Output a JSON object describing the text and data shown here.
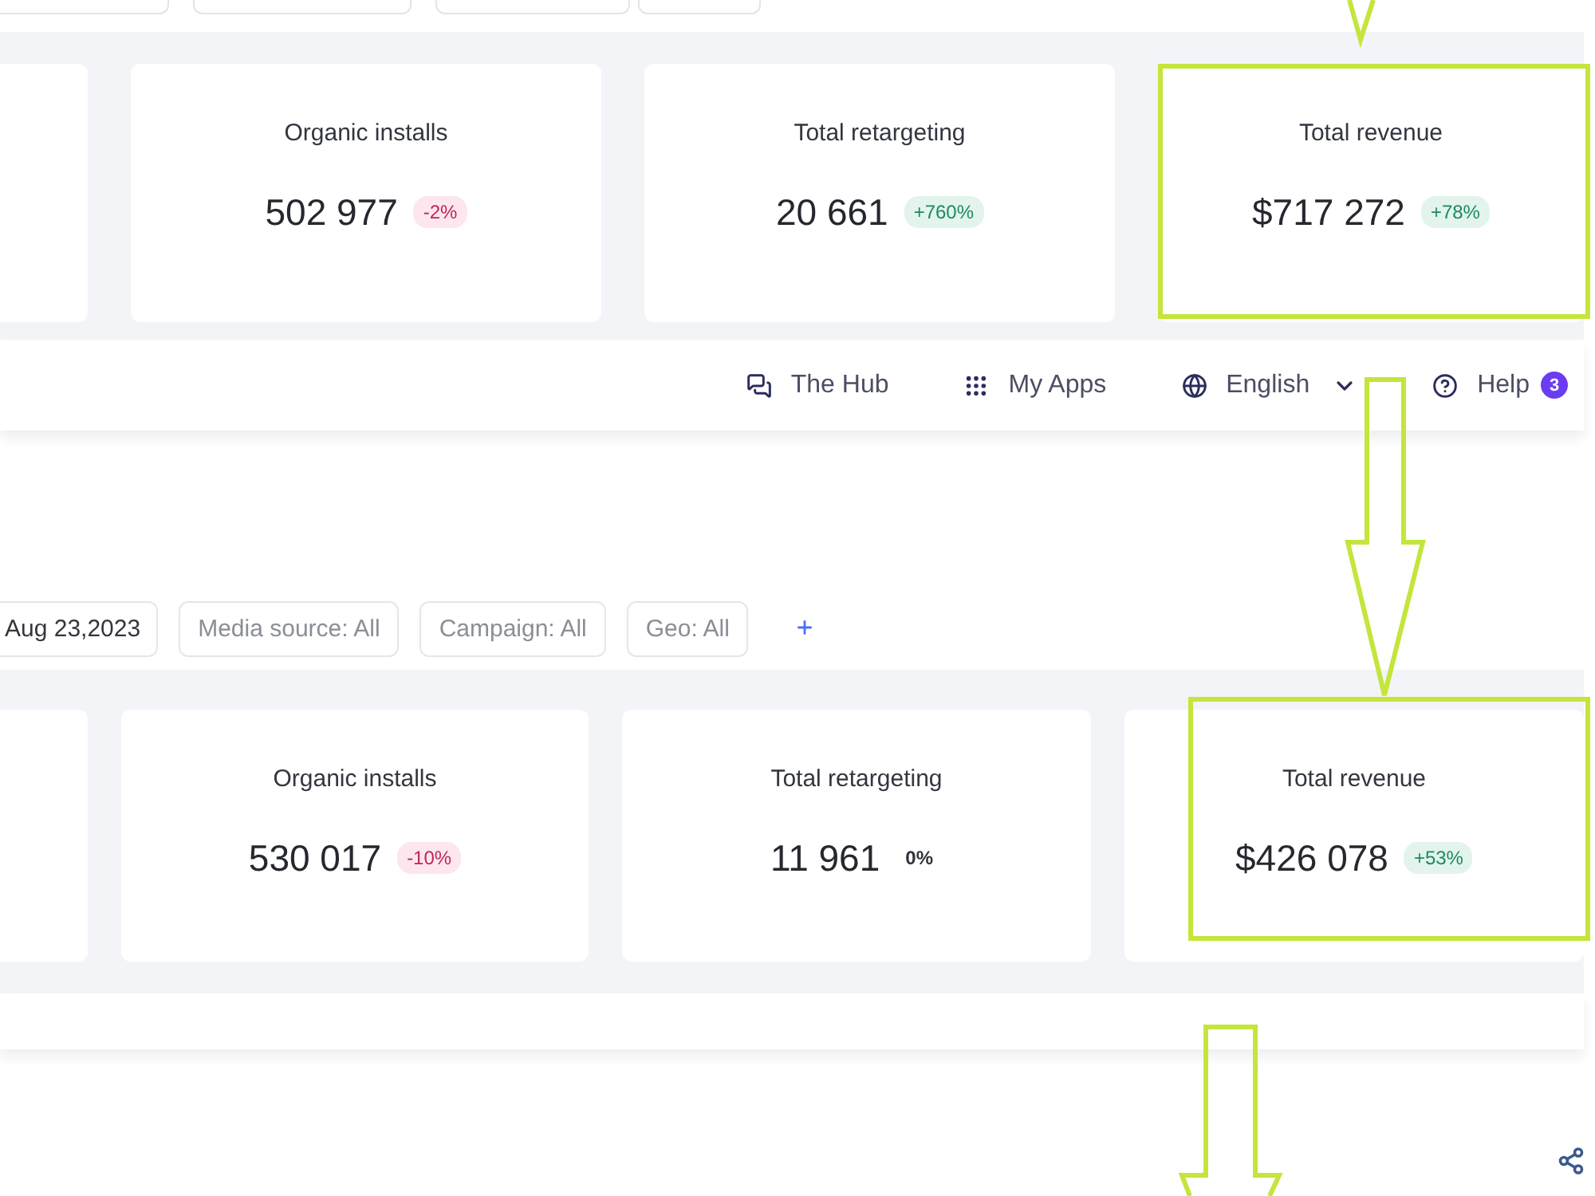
{
  "summary_top": {
    "cards": [
      {
        "label": "Organic installs",
        "value": "502 977",
        "change": "-2%",
        "kind": "down",
        "highlighted": false
      },
      {
        "label": "Total retargeting",
        "value": "20 661",
        "change": "+760%",
        "kind": "up",
        "highlighted": false
      },
      {
        "label": "Total revenue",
        "value": "$717 272",
        "change": "+78%",
        "kind": "up",
        "highlighted": true
      }
    ]
  },
  "nav_bar": {
    "items": [
      {
        "label": "The Hub",
        "kind": "chat",
        "dropdown": false
      },
      {
        "label": "My Apps",
        "kind": "grid",
        "dropdown": false
      },
      {
        "label": "English",
        "kind": "globe",
        "dropdown": true
      },
      {
        "label": "Help",
        "kind": "help",
        "dropdown": false,
        "badge": "3"
      }
    ]
  },
  "filters": [
    {
      "label": "Aug 23,2023",
      "kind": "date"
    },
    {
      "label": "Media source: All",
      "kind": "select"
    },
    {
      "label": "Campaign: All",
      "kind": "select"
    },
    {
      "label": "Geo: All",
      "kind": "select"
    }
  ],
  "summary_bottom": {
    "cards": [
      {
        "label": "Organic installs",
        "value": "530 017",
        "change": "-10%",
        "kind": "down",
        "highlighted": false
      },
      {
        "label": "Total retargeting",
        "value": "11 961",
        "change": "0%",
        "kind": "flat",
        "highlighted": false
      },
      {
        "label": "Total revenue",
        "value": "$426 078",
        "change": "+53%",
        "kind": "up",
        "highlighted": true
      }
    ]
  }
}
